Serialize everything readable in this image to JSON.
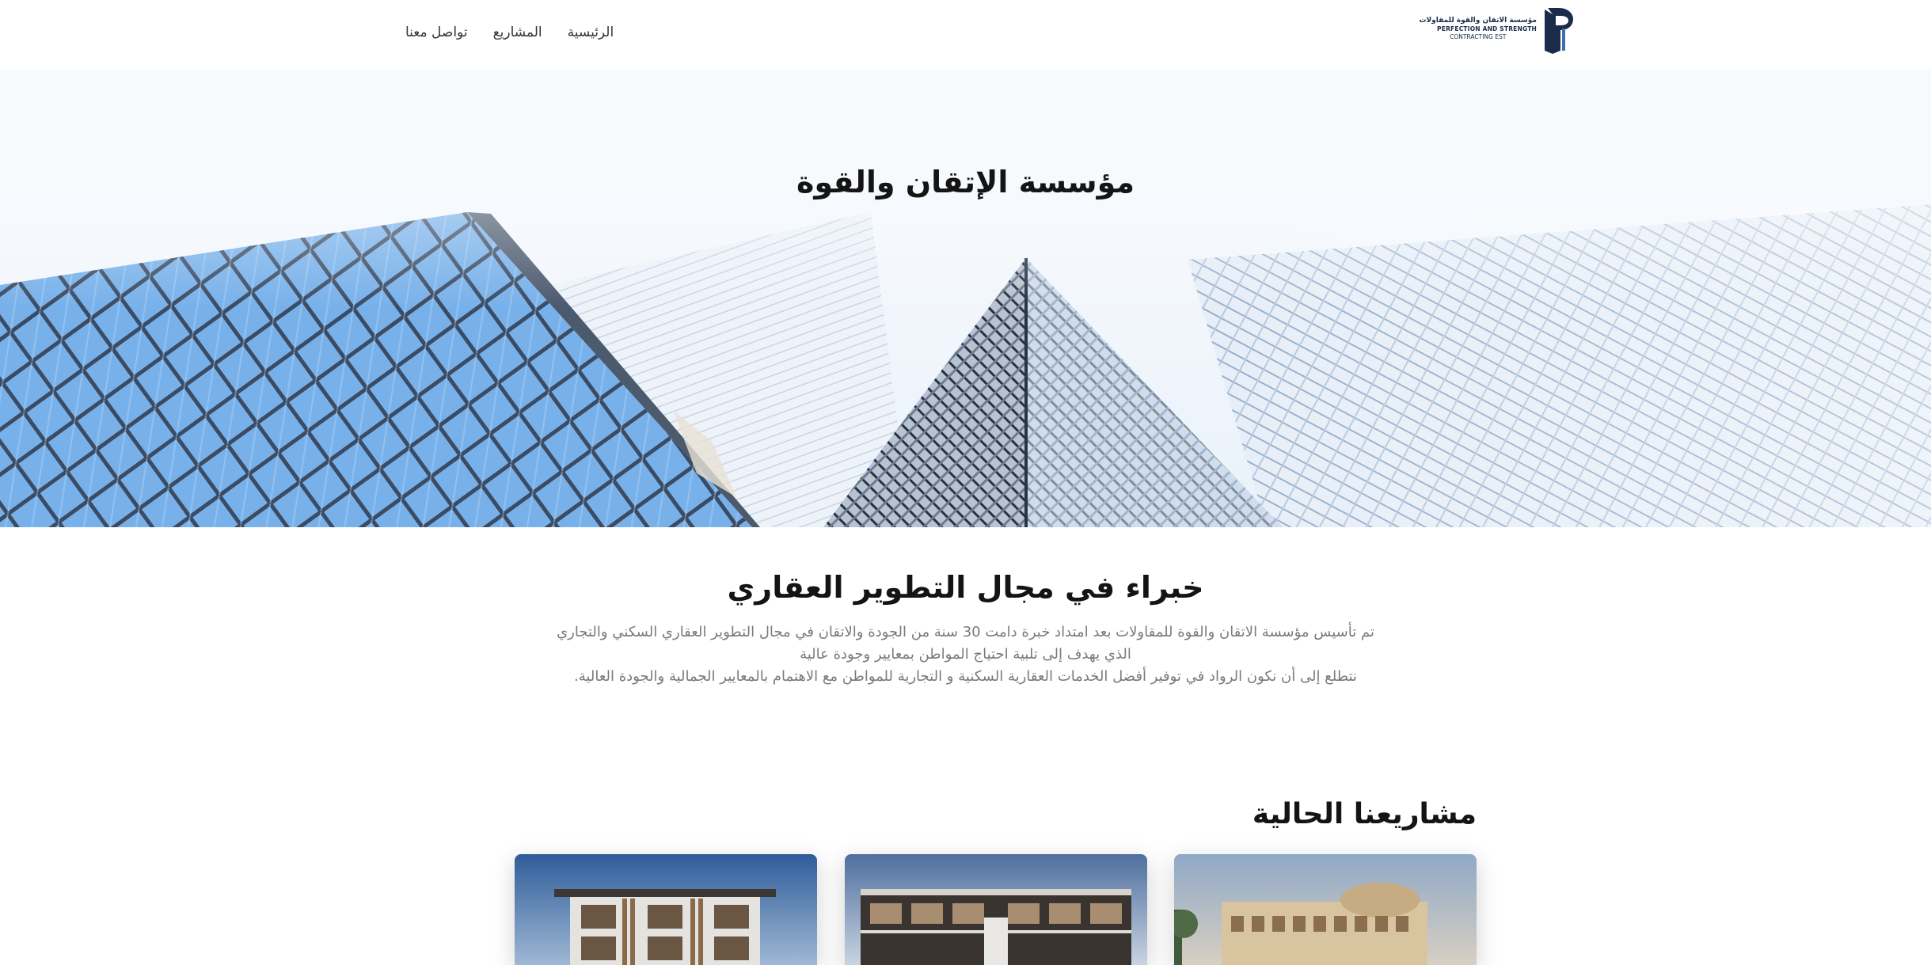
{
  "header": {
    "logo": {
      "ar_text": "مؤسسة الاتقان والقوة للمقاولات",
      "en_line1": "PERFECTION AND STRENGTH",
      "en_line2": "CONTRACTING EST"
    },
    "nav": [
      {
        "label": "الرئيسية"
      },
      {
        "label": "المشاريع"
      },
      {
        "label": "تواصل معنا"
      }
    ]
  },
  "hero": {
    "title": "مؤسسة الإتقان والقوة"
  },
  "about": {
    "title": "خبراء في مجال التطوير العقاري",
    "lines": [
      "تم تأسيس مؤسسة الاتقان والقوة للمقاولات بعد امتداد خبرة دامت 30 سنة من الجودة والاتقان في مجال التطوير العقاري السكني والتجاري",
      "الذي يهدف إلى تلبية احتياج المواطن بمعايير وجودة عالية",
      "نتطلع إلى أن نكون الرواد في توفير أفضل الخدمات العقارية السكنية و التجارية للمواطن مع الاهتمام بالمعايير الجمالية والجودة العالية."
    ]
  },
  "projects": {
    "title": "مشاريعنا الحالية"
  },
  "colors": {
    "brand_navy": "#1b2b4a",
    "glass_blue": "#6ea8e6",
    "text_muted": "#7a7a7a"
  }
}
